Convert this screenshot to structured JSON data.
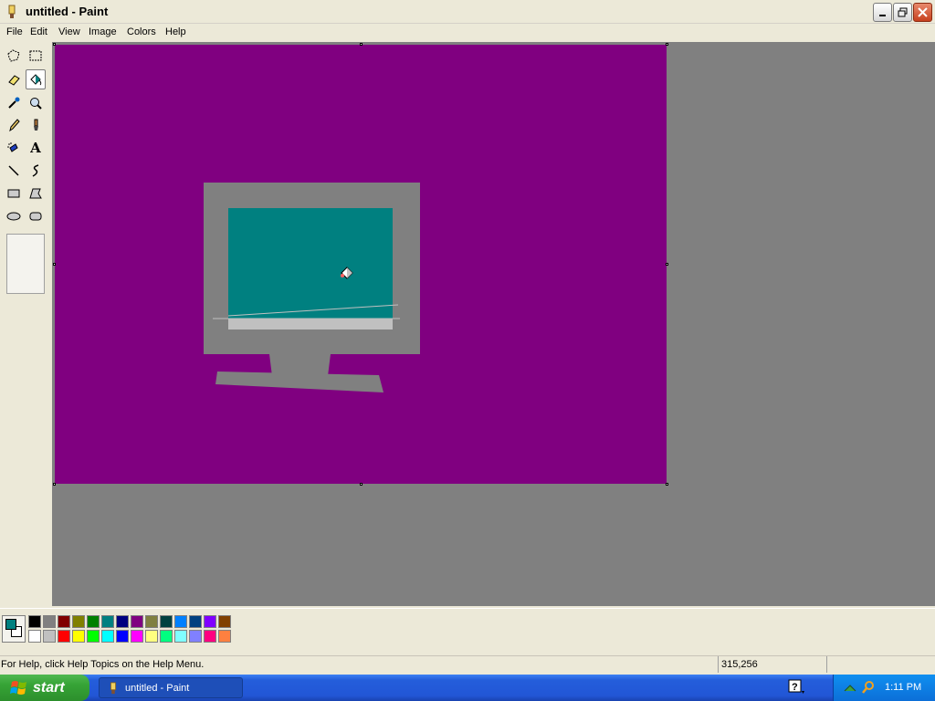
{
  "window": {
    "title": "untitled - Paint"
  },
  "menu": [
    "File",
    "Edit",
    "View",
    "Image",
    "Colors",
    "Help"
  ],
  "tools": [
    {
      "name": "free-form-select",
      "active": false
    },
    {
      "name": "rectangle-select",
      "active": false
    },
    {
      "name": "eraser",
      "active": false
    },
    {
      "name": "fill-with-color",
      "active": true
    },
    {
      "name": "pick-color",
      "active": false
    },
    {
      "name": "magnifier",
      "active": false
    },
    {
      "name": "pencil",
      "active": false
    },
    {
      "name": "brush",
      "active": false
    },
    {
      "name": "airbrush",
      "active": false
    },
    {
      "name": "text",
      "active": false,
      "glyph": "A"
    },
    {
      "name": "line",
      "active": false
    },
    {
      "name": "curve",
      "active": false
    },
    {
      "name": "rectangle",
      "active": false
    },
    {
      "name": "polygon",
      "active": false
    },
    {
      "name": "ellipse",
      "active": false
    },
    {
      "name": "rounded-rectangle",
      "active": false
    }
  ],
  "canvas": {
    "background_color": "#800080",
    "drawing": {
      "monitor_frame_color": "#808080",
      "screen_color": "#008080",
      "screen_bottom_color": "#c0c0c0"
    }
  },
  "colors": {
    "foreground": "#008080",
    "background": "#ffffff",
    "palette_top": [
      "#000000",
      "#808080",
      "#800000",
      "#808000",
      "#008000",
      "#008080",
      "#000080",
      "#800080",
      "#808040",
      "#004040",
      "#0080ff",
      "#004080",
      "#8000ff",
      "#804000"
    ],
    "palette_bottom": [
      "#ffffff",
      "#c0c0c0",
      "#ff0000",
      "#ffff00",
      "#00ff00",
      "#00ffff",
      "#0000ff",
      "#ff00ff",
      "#ffff80",
      "#00ff80",
      "#80ffff",
      "#8080ff",
      "#ff0080",
      "#ff8040"
    ]
  },
  "status": {
    "help_text": "For Help, click Help Topics on the Help Menu.",
    "coords": "315,256"
  },
  "taskbar": {
    "start_label": "start",
    "task_label": "untitled - Paint",
    "clock": "1:11 PM"
  }
}
